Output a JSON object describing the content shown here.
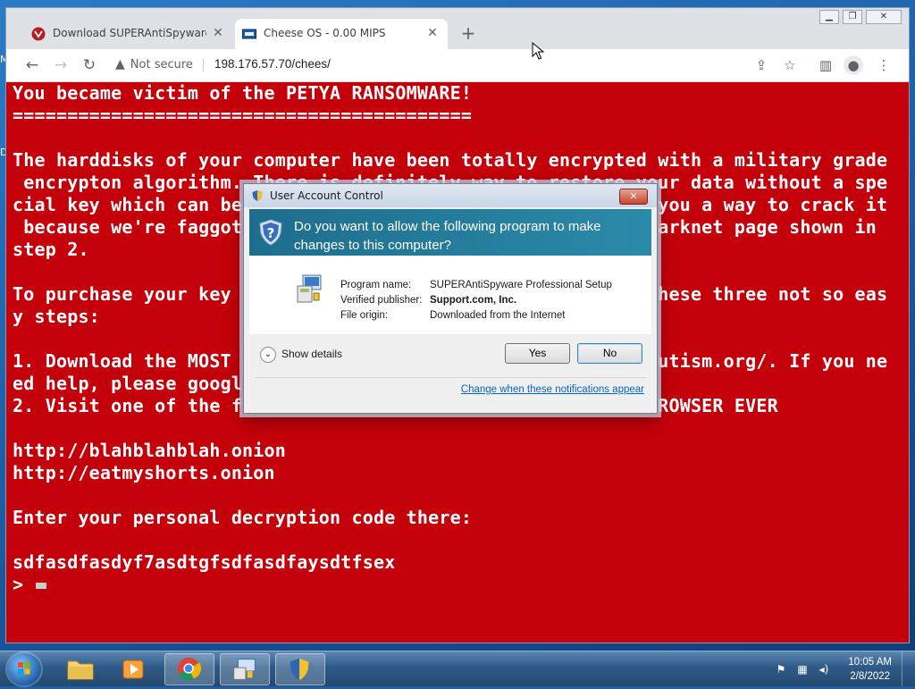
{
  "desktop": {
    "edge_letters": [
      "M",
      "D"
    ]
  },
  "browser": {
    "tabs": [
      {
        "title": "Download SUPERAntiSpyware Pr",
        "favicon": "superantispyware-icon",
        "active": false
      },
      {
        "title": "Cheese OS - 0.00 MIPS",
        "favicon": "cheese-os-icon",
        "active": true
      }
    ],
    "new_tab": "+",
    "window_controls": [
      "minimize",
      "restore",
      "close"
    ],
    "security_label": "Not secure",
    "url": "198.176.57.70/chees/"
  },
  "ransom_screen": {
    "lines": [
      "You became victim of the PETYA RANSOMWARE!",
      "==========================================",
      "",
      "The harddisks of your computer have been totally encrypted with a military grade",
      " encrypton algorithm. There is definitely way to restore your data without a spe",
      "cial key which can be                                      you a way to crack it",
      " because we're faggot                                     darknet page shown in",
      "step 2.",
      "",
      "To purchase your key                                      these three not so eas",
      "y steps:",
      "",
      "1. Download the MOST                                      autism.org/. If you ne",
      "ed help, please googl",
      "2. Visit one of the f                                     BROWSER EVER",
      "",
      "http://blahblahblah.onion",
      "http://eatmyshorts.onion",
      "",
      "Enter your personal decryption code there:",
      "",
      "sdfasdfasdyf7asdtgfsdfasdfaysdtfsex",
      ">"
    ]
  },
  "uac": {
    "title": "User Account Control",
    "close_label": "✕",
    "question": "Do you want to allow the following program to make changes to this computer?",
    "fields": [
      {
        "key": "Program name:",
        "value": "SUPERAntiSpyware Professional Setup",
        "bold": false
      },
      {
        "key": "Verified publisher:",
        "value": "Support.com, Inc.",
        "bold": true
      },
      {
        "key": "File origin:",
        "value": "Downloaded from the Internet",
        "bold": false
      }
    ],
    "show_details": "Show details",
    "yes": "Yes",
    "no": "No",
    "notifications_link": "Change when these notifications appear"
  },
  "taskbar": {
    "pinned": [
      "explorer-folder-icon",
      "media-player-icon",
      "chrome-icon",
      "installer-icon",
      "uac-shield-icon"
    ],
    "tray_icons": [
      "action-center-flag-icon",
      "network-icon",
      "volume-icon"
    ],
    "time": "10:05 AM",
    "date": "2/8/2022"
  },
  "colors": {
    "ransom_bg": "#c4000a",
    "uac_header": "#1e6d8e",
    "link": "#0066cc"
  }
}
